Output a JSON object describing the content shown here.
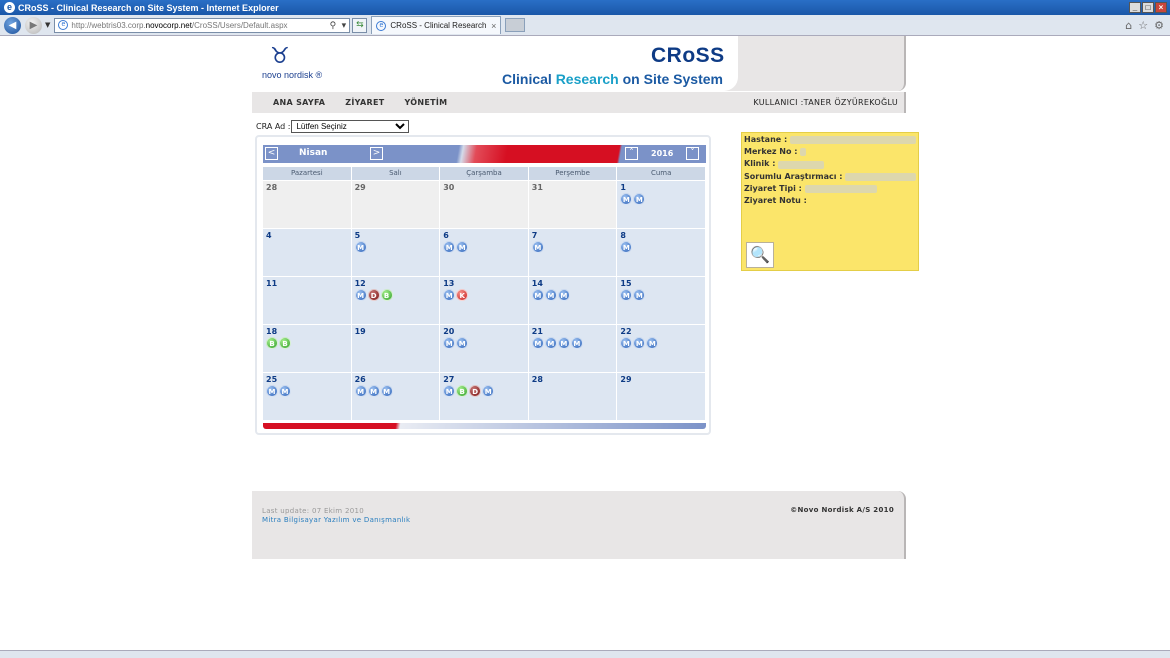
{
  "window": {
    "title": "CRoSS - Clinical Research on Site System - Internet Explorer"
  },
  "browser": {
    "url_prefix": "http://webtris03.corp.",
    "url_host": "novocorp.net",
    "url_path": "/CroSS/Users/Default.aspx",
    "tab_title": "CRoSS - Clinical Research on..."
  },
  "header": {
    "logo_text": "novo nordisk ®",
    "brand": "CRoSS",
    "subtitle_c": "Clinical ",
    "subtitle_r": "Research ",
    "subtitle_rest": "on Site System"
  },
  "menu": {
    "items": [
      "ANA SAYFA",
      "ZİYARET",
      "YÖNETİM"
    ],
    "user": "KULLANICI :TANER ÖZYÜREKOĞLU"
  },
  "cra": {
    "label": "CRA Ad :",
    "selected": "Lütfen Seçiniz"
  },
  "calendar": {
    "month": "Nisan",
    "year": "2016",
    "days": [
      "Pazartesi",
      "Salı",
      "Çarşamba",
      "Perşembe",
      "Cuma"
    ],
    "weeks": [
      [
        {
          "d": "28",
          "prev": true,
          "b": []
        },
        {
          "d": "29",
          "prev": true,
          "b": []
        },
        {
          "d": "30",
          "prev": true,
          "b": []
        },
        {
          "d": "31",
          "prev": true,
          "b": []
        },
        {
          "d": "1",
          "b": [
            "M",
            "M"
          ]
        }
      ],
      [
        {
          "d": "4",
          "b": []
        },
        {
          "d": "5",
          "b": [
            "M"
          ]
        },
        {
          "d": "6",
          "b": [
            "M",
            "M"
          ]
        },
        {
          "d": "7",
          "b": [
            "M"
          ]
        },
        {
          "d": "8",
          "b": [
            "M"
          ]
        }
      ],
      [
        {
          "d": "11",
          "b": []
        },
        {
          "d": "12",
          "b": [
            "M",
            "D",
            "B"
          ]
        },
        {
          "d": "13",
          "b": [
            "M",
            "K"
          ]
        },
        {
          "d": "14",
          "b": [
            "M",
            "M",
            "M"
          ]
        },
        {
          "d": "15",
          "b": [
            "M",
            "M"
          ]
        }
      ],
      [
        {
          "d": "18",
          "b": [
            "B",
            "B"
          ]
        },
        {
          "d": "19",
          "b": []
        },
        {
          "d": "20",
          "b": [
            "M",
            "M"
          ]
        },
        {
          "d": "21",
          "b": [
            "M",
            "M",
            "M",
            "M"
          ]
        },
        {
          "d": "22",
          "b": [
            "M",
            "M",
            "M"
          ]
        }
      ],
      [
        {
          "d": "25",
          "b": [
            "M",
            "M"
          ]
        },
        {
          "d": "26",
          "b": [
            "M",
            "M",
            "M"
          ]
        },
        {
          "d": "27",
          "b": [
            "M",
            "B",
            "D",
            "M"
          ]
        },
        {
          "d": "28",
          "b": []
        },
        {
          "d": "29",
          "b": []
        }
      ]
    ]
  },
  "info": {
    "hospital": "Hastane :",
    "center": "Merkez No :",
    "clinic": "Klinik :",
    "investigator": "Sorumlu Araştırmacı :",
    "visit_type": "Ziyaret Tipi :",
    "visit_note": "Ziyaret Notu :"
  },
  "footer": {
    "last_update": "Last update: 07 Ekim 2010",
    "company": "Mitra Bilgisayar Yazılım ve Danışmanlık",
    "copyright": "©Novo Nordisk A/S 2010"
  },
  "colors": {
    "badge_M": "#2b62b8",
    "badge_B": "#2e9f26",
    "badge_K": "#c81d1d",
    "badge_D": "#7a1010"
  }
}
